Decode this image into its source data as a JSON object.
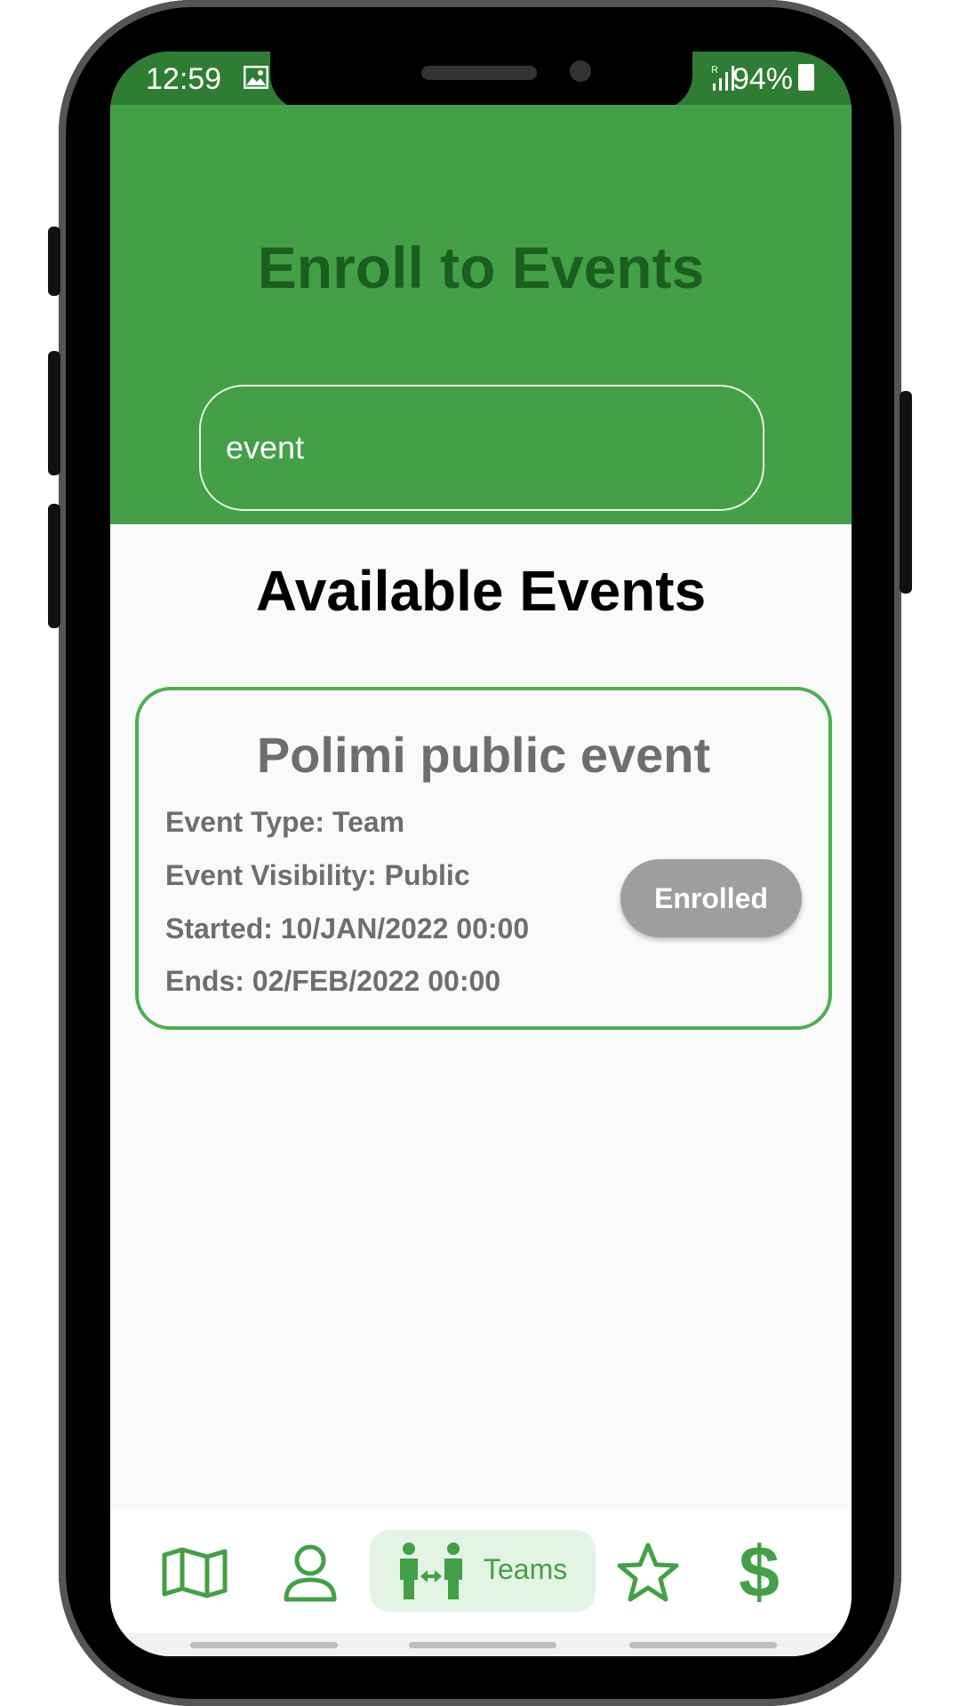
{
  "status_bar": {
    "time": "12:59",
    "battery": "94%",
    "signal_label": "R"
  },
  "header": {
    "title": "Enroll to Events"
  },
  "search": {
    "value": "event"
  },
  "section": {
    "title": "Available Events"
  },
  "event_card": {
    "name": "Polimi public event",
    "type": "Event Type: Team",
    "visibility": "Event Visibility: Public",
    "started": "Started: 10/JAN/2022 00:00",
    "ends": "Ends: 02/FEB/2022 00:00",
    "status_button": "Enrolled"
  },
  "bottom_nav": {
    "items": [
      {
        "icon": "map-icon"
      },
      {
        "icon": "person-icon"
      },
      {
        "icon": "teams-icon",
        "label": "Teams",
        "active": true
      },
      {
        "icon": "star-icon"
      },
      {
        "icon": "dollar-icon",
        "glyph": "$"
      }
    ]
  },
  "colors": {
    "header_green": "#43a047",
    "status_green": "#2e7d32",
    "title_dark_green": "#1b5e20",
    "card_border": "#4caf50",
    "enrolled_grey": "#9e9e9e"
  }
}
